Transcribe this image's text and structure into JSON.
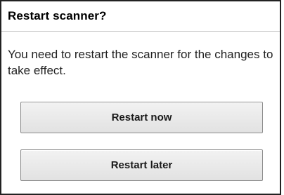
{
  "dialog": {
    "title": "Restart scanner?",
    "message": "You need to restart the scanner for the changes to take effect.",
    "buttons": {
      "restart_now": "Restart now",
      "restart_later": "Restart later"
    }
  }
}
